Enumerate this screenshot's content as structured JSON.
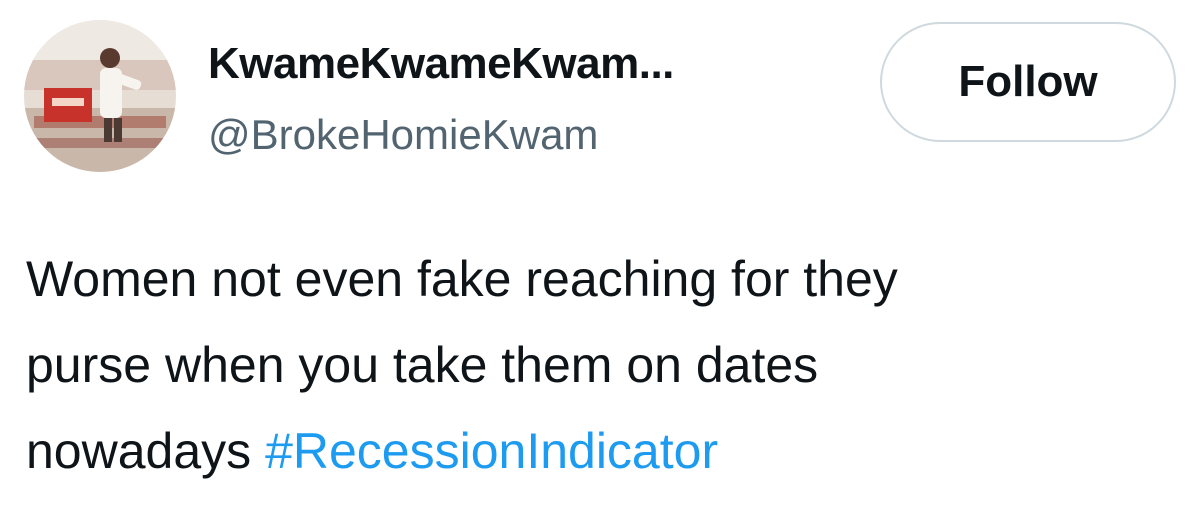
{
  "user": {
    "display_name": "KwameKwameKwam...",
    "handle": "@BrokeHomieKwam",
    "avatar_icon": "profile-photo"
  },
  "follow_button": {
    "label": "Follow"
  },
  "tweet": {
    "text_lines": [
      "Women not even fake reaching for they",
      "purse when you take them on dates",
      "nowadays"
    ],
    "hashtag": "#RecessionIndicator"
  },
  "colors": {
    "text": "#0f1419",
    "secondary_text": "#536471",
    "link": "#1d9bf0",
    "button_border": "#cfd9de",
    "background": "#ffffff"
  }
}
